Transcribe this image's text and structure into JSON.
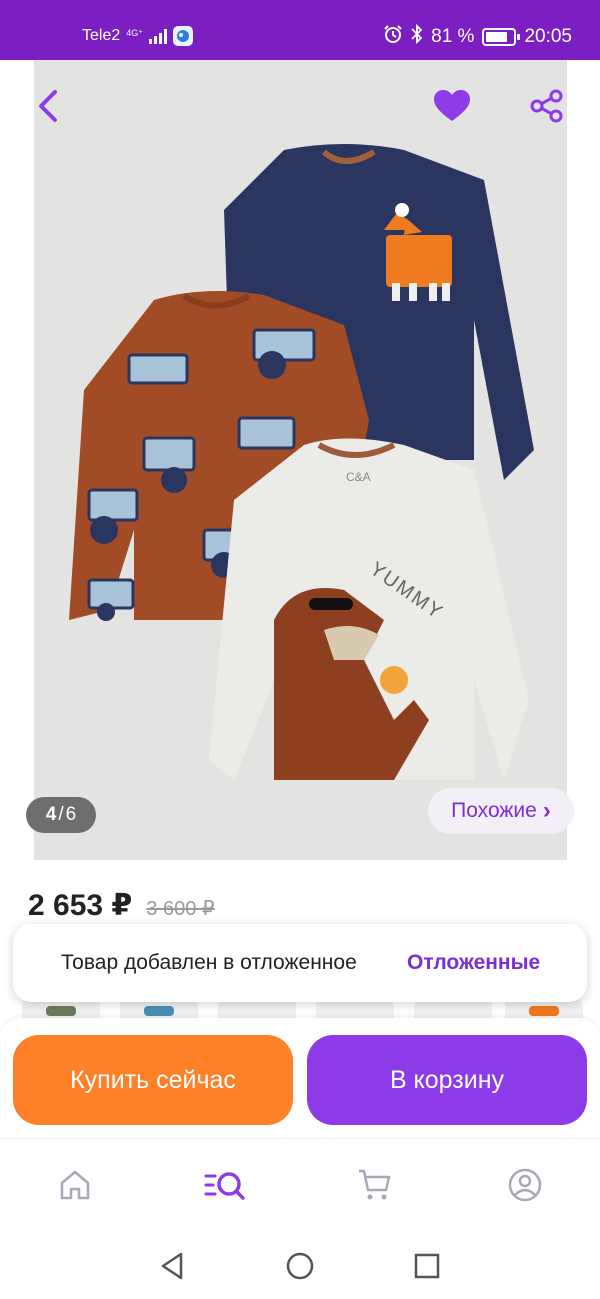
{
  "status_bar": {
    "carrier": "Tele2",
    "network": "4G⁺",
    "battery": "81 %",
    "battery_level": 0.81,
    "time": "20:05"
  },
  "gallery": {
    "counter_current": "4",
    "counter_sep": "/",
    "counter_total": "6",
    "similar_label": "Похожие",
    "similar_chevron": "›",
    "photo_brand": "C&A",
    "photo_text": "YUMMY"
  },
  "product": {
    "price": "2 653 ₽",
    "old_price": "3 600 ₽"
  },
  "toast": {
    "message": "Товар добавлен в отложенное",
    "link": "Отложенные"
  },
  "actions": {
    "buy_now": "Купить сейчас",
    "to_cart": "В корзину"
  },
  "bottom_nav": {
    "items": [
      {
        "icon": "home-icon",
        "active": false
      },
      {
        "icon": "catalog-search-icon",
        "active": true
      },
      {
        "icon": "cart-icon",
        "active": false
      },
      {
        "icon": "profile-icon",
        "active": false
      }
    ]
  },
  "colors": {
    "brand": "#7b1fc2",
    "accent_purple": "#8d3be9",
    "accent_orange": "#ff8127",
    "favorite": "#8d3be9"
  }
}
